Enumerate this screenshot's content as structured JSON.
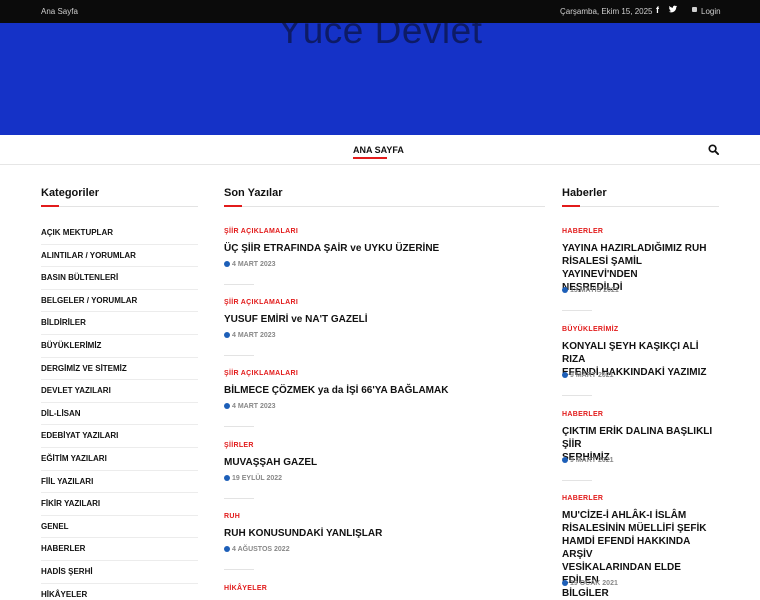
{
  "topbar": {
    "home": "Ana Sayfa",
    "date": "Çarşamba, Ekim 15, 2025",
    "facebook_glyph": "f",
    "login": "Login",
    "icons": [
      "facebook-icon",
      "twitter-icon",
      "lock-icon"
    ]
  },
  "header": {
    "logo_text": "Yüce Devlet",
    "background": "#1532c7"
  },
  "nav": {
    "active_item": "ANA SAYFA",
    "accent": "#e21b1b",
    "icons": [
      "search-icon"
    ]
  },
  "sidebar": {
    "title": "Kategoriler",
    "items": [
      "AÇIK MEKTUPLAR",
      "ALINTILAR / YORUMLAR",
      "BASIN BÜLTENLERİ",
      "BELGELER / YORUMLAR",
      "BİLDİRİLER",
      "BÜYÜKLERİMİZ",
      "DERGİMİZ VE SİTEMİZ",
      "DEVLET YAZILARI",
      "DİL-LİSAN",
      "EDEBİYAT YAZILARI",
      "EĞİTİM YAZILARI",
      "FİİL YAZILARI",
      "FİKİR YAZILARI",
      "GENEL",
      "HABERLER",
      "HADİS ŞERHİ",
      "HİKÂYELER"
    ]
  },
  "recent": {
    "title": "Son Yazılar",
    "posts": [
      {
        "category": "ŞİİR AÇIKLAMALARI",
        "title": "ÜÇ ŞİİR ETRAFINDA ŞAİR ve UYKU ÜZERİNE",
        "date": "4 MART 2023"
      },
      {
        "category": "ŞİİR AÇIKLAMALARI",
        "title": "YUSUF EMİRİ ve NA'T GAZELİ",
        "date": "4 MART 2023"
      },
      {
        "category": "ŞİİR AÇIKLAMALARI",
        "title": "BİLMECE ÇÖZMEK ya da İŞİ 66'YA BAĞLAMAK",
        "date": "4 MART 2023"
      },
      {
        "category": "ŞİİRLER",
        "title": "MUVAŞŞAH GAZEL",
        "date": "19 EYLÜL 2022"
      },
      {
        "category": "RUH",
        "title": "RUH KONUSUNDAKİ YANLIŞLAR",
        "date": "4 AĞUSTOS 2022"
      },
      {
        "category": "HİKÂYELER",
        "title": "",
        "date": ""
      }
    ]
  },
  "news": {
    "title": "Haberler",
    "posts": [
      {
        "category": "HABERLER",
        "title_lines": [
          "YAYINA HAZIRLADIĞIMIZ RUH",
          "RİSALESİ ŞAMİL YAYINEVİ'NDEN",
          "NEŞREDİLDİ"
        ],
        "date": "13 MAYIS 2021"
      },
      {
        "category": "BÜYÜKLERİMİZ",
        "title_lines": [
          "KONYALI ŞEYH KAŞIKÇI ALİ RIZA",
          "EFENDİ HAKKINDAKİ YAZIMIZ"
        ],
        "date": "9 MART 2021"
      },
      {
        "category": "HABERLER",
        "title_lines": [
          "ÇIKTIM ERİK DALINA BAŞLIKLI ŞİİR",
          "ŞERHİMİZ"
        ],
        "date": "9 MART 2021"
      },
      {
        "category": "HABERLER",
        "title_lines": [
          "MU'CİZE-İ AHLÂK-I İSLÂM",
          "RİSALESİNİN MÜELLİFİ ŞEFİK",
          "HAMDİ EFENDİ HAKKINDA ARŞİV",
          "VESİKALARINDAN ELDE EDİLEN",
          "BİLGİLER"
        ],
        "date": "19 OCAK 2021"
      }
    ]
  }
}
